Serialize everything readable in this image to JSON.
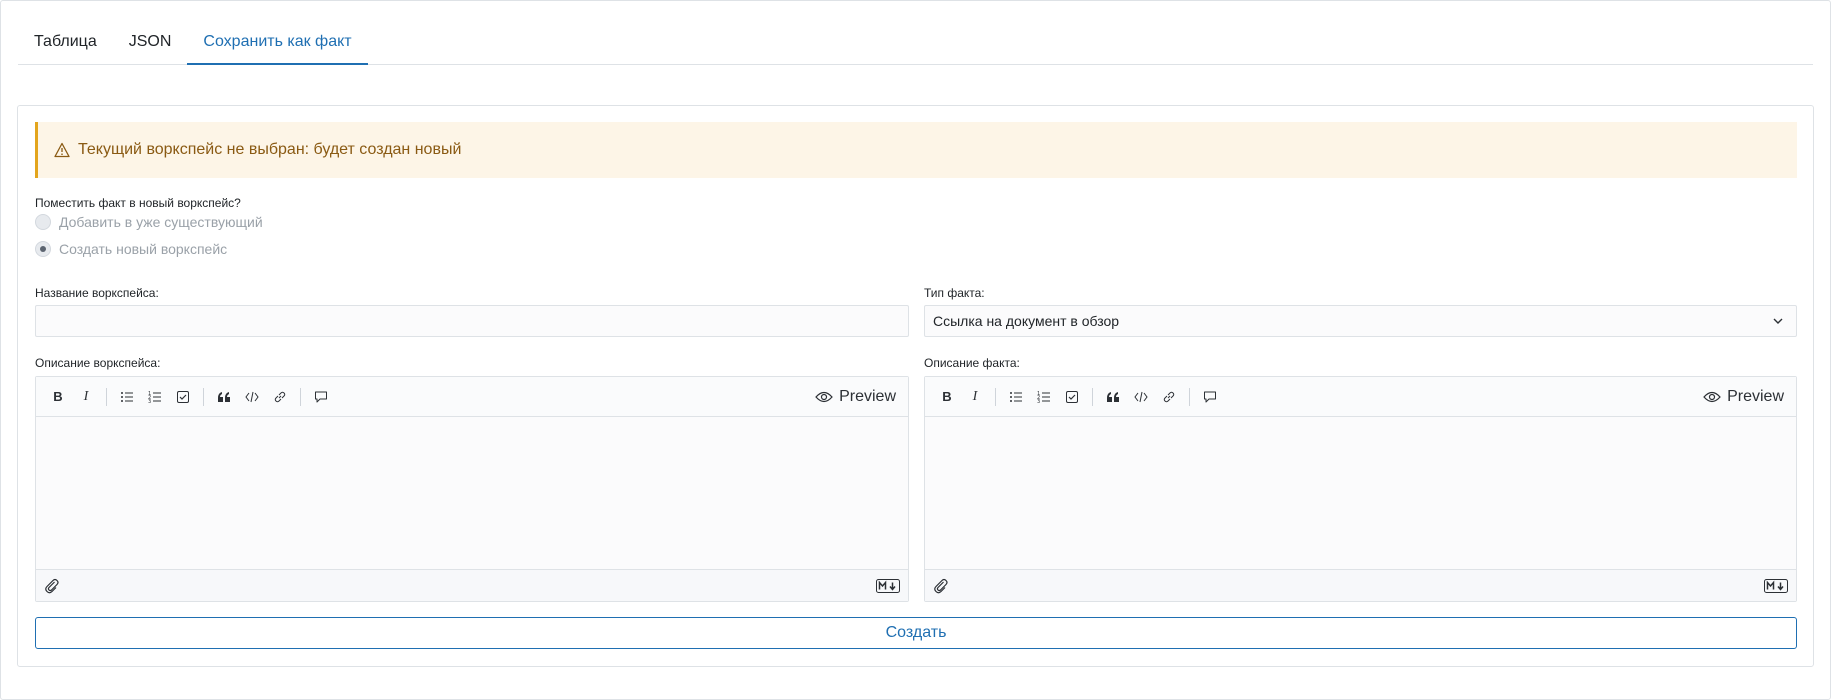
{
  "tabs": [
    {
      "label": "Таблица"
    },
    {
      "label": "JSON"
    },
    {
      "label": "Сохранить как факт"
    }
  ],
  "alert": {
    "text": "Текущий воркспейс не выбран: будет создан новый"
  },
  "workspace_question": {
    "label": "Поместить факт в новый воркспейс?",
    "options": [
      {
        "label": "Добавить в уже существующий",
        "selected": false
      },
      {
        "label": "Создать новый воркспейс",
        "selected": true
      }
    ]
  },
  "workspace_name": {
    "label": "Название воркспейса:",
    "value": ""
  },
  "fact_type": {
    "label": "Тип факта:",
    "value": "Ссылка на документ в обзор"
  },
  "workspace_description": {
    "label": "Описание воркспейса:"
  },
  "fact_description": {
    "label": "Описание факта:"
  },
  "editor": {
    "preview_label": "Preview"
  },
  "create_button": {
    "label": "Создать"
  },
  "colors": {
    "accent": "#1f6fb2",
    "alert_bg": "#fdf5e7",
    "alert_border": "#e3a51d"
  }
}
